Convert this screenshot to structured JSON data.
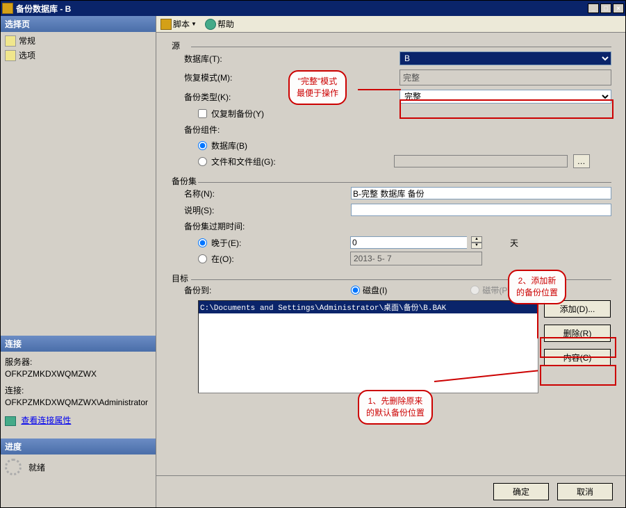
{
  "window": {
    "title": "备份数据库 - B"
  },
  "sidebar": {
    "select_page": "选择页",
    "items": [
      {
        "label": "常规"
      },
      {
        "label": "选项"
      }
    ],
    "connection": "连接",
    "server_label": "服务器:",
    "server_value": "OFKPZMKDXWQMZWX",
    "conn_label": "连接:",
    "conn_value": "OFKPZMKDXWQMZWX\\Administrator",
    "view_props": "查看连接属性",
    "progress": "进度",
    "ready": "就绪"
  },
  "toolbar": {
    "script": "脚本",
    "help": "帮助"
  },
  "source": {
    "group": "源",
    "database_label": "数据库(T):",
    "database_value": "B",
    "recovery_label": "恢复模式(M):",
    "recovery_value": "完整",
    "backup_type_label": "备份类型(K):",
    "backup_type_value": "完整",
    "copy_only": "仅复制备份(Y)",
    "component": "备份组件:",
    "radio_db": "数据库(B)",
    "radio_fg": "文件和文件组(G):"
  },
  "backup_set": {
    "group": "备份集",
    "name_label": "名称(N):",
    "name_value": "B-完整 数据库 备份",
    "desc_label": "说明(S):",
    "desc_value": "",
    "expire_label": "备份集过期时间:",
    "radio_after": "晚于(E):",
    "after_value": "0",
    "after_unit": "天",
    "radio_on": "在(O):",
    "on_value": "2013- 5- 7"
  },
  "destination": {
    "group": "目标",
    "to_label": "备份到:",
    "radio_disk": "磁盘(I)",
    "radio_tape": "磁带(P)",
    "path": "C:\\Documents and Settings\\Administrator\\桌面\\备份\\B.BAK",
    "add": "添加(D)...",
    "remove": "删除(R)",
    "contents": "内容(C)"
  },
  "buttons": {
    "ok": "确定",
    "cancel": "取消"
  },
  "annotations": {
    "a1": "\"完整\"模式\n最便于操作",
    "a2": "2、添加新\n的备份位置",
    "a3": "1、先删除原来\n的默认备份位置"
  }
}
